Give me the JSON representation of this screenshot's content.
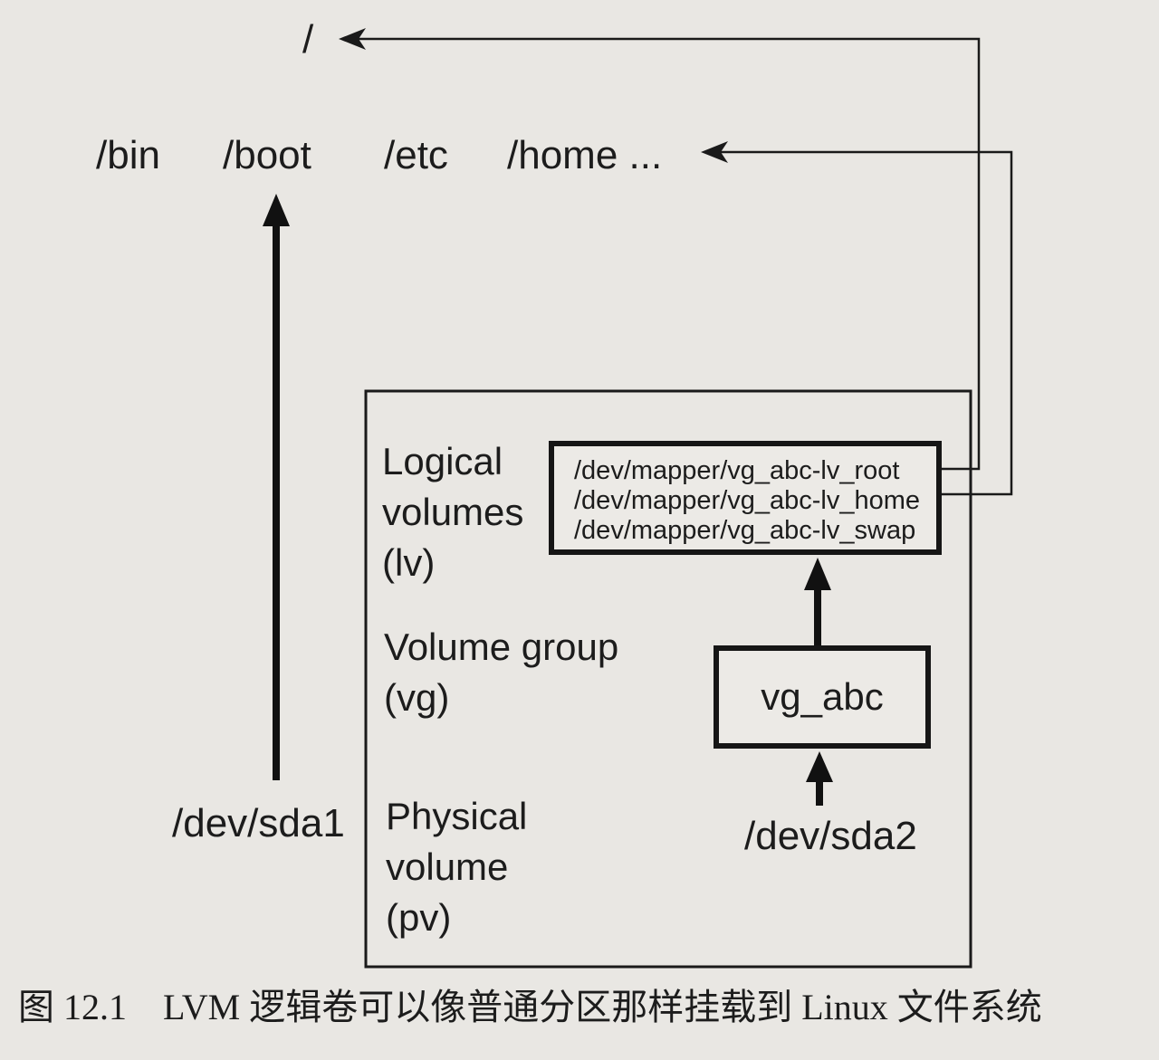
{
  "root_dir": "/",
  "dirs": [
    "/bin",
    "/boot",
    "/etc",
    "/home ..."
  ],
  "partition": "/dev/sda1",
  "lvm": {
    "lv_label": [
      "Logical",
      "volumes",
      "(lv)"
    ],
    "vg_label": [
      "Volume group",
      "(vg)"
    ],
    "pv_label": [
      "Physical",
      "volume",
      "(pv)"
    ],
    "logical_volumes": [
      "/dev/mapper/vg_abc-lv_root",
      "/dev/mapper/vg_abc-lv_home",
      "/dev/mapper/vg_abc-lv_swap"
    ],
    "volume_group": "vg_abc",
    "physical_volume": "/dev/sda2"
  },
  "caption": "图 12.1　LVM 逻辑卷可以像普通分区那样挂载到 Linux 文件系统"
}
